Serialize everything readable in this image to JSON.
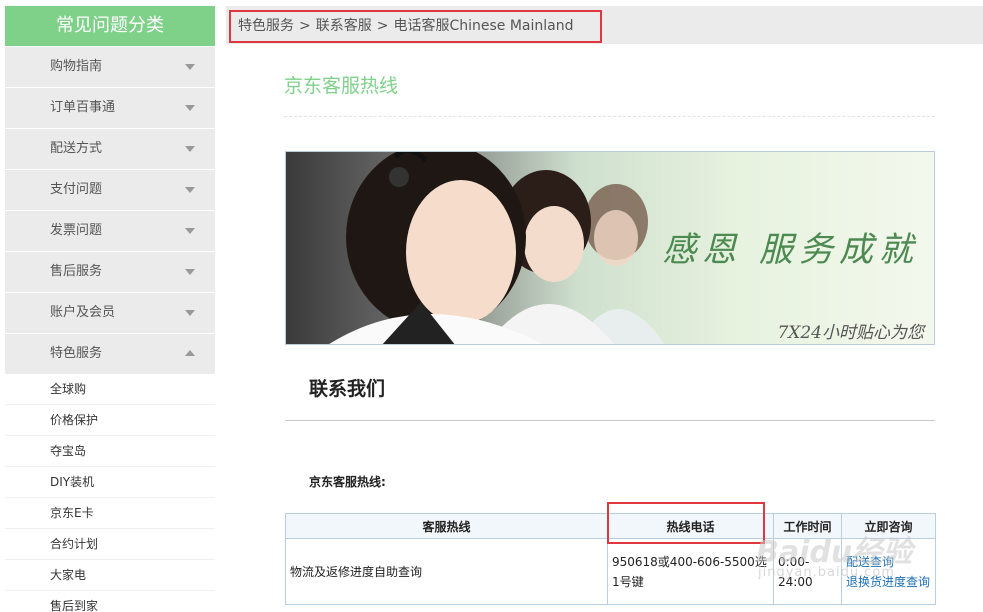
{
  "sidebar": {
    "title": "常见问题分类",
    "categories": [
      {
        "label": "购物指南",
        "expanded": false
      },
      {
        "label": "订单百事通",
        "expanded": false
      },
      {
        "label": "配送方式",
        "expanded": false
      },
      {
        "label": "支付问题",
        "expanded": false
      },
      {
        "label": "发票问题",
        "expanded": false
      },
      {
        "label": "售后服务",
        "expanded": false
      },
      {
        "label": "账户及会员",
        "expanded": false
      },
      {
        "label": "特色服务",
        "expanded": true
      }
    ],
    "sub_items": [
      "全球购",
      "价格保护",
      "夺宝岛",
      "DIY装机",
      "京东E卡",
      "合约计划",
      "大家电",
      "售后到家"
    ]
  },
  "breadcrumb": {
    "items": [
      "特色服务",
      "联系客服",
      "电话客服Chinese Mainland"
    ],
    "separator": ">"
  },
  "main": {
    "page_title": "京东客服热线",
    "banner": {
      "slogan": "感恩 服务成就",
      "subtitle": "7X24小时贴心为您"
    },
    "section_title": "联系我们",
    "hotline_label": "京东客服热线:",
    "table": {
      "headers": [
        "客服热线",
        "热线电话",
        "工作时间",
        "立即咨询"
      ],
      "rows": [
        {
          "service": "物流及返修进度自助查询",
          "phone": "950618或400-606-5500选1号键",
          "hours": "0:00-24:00",
          "links": [
            "配送查询",
            "退换货进度查询"
          ]
        }
      ]
    }
  },
  "watermark": {
    "text": "Baidu经验",
    "sub": "jingyan.baidu.com"
  },
  "colors": {
    "accent_green": "#7fd18a",
    "highlight_red": "#e0363d",
    "link_blue": "#1a6fb5"
  }
}
